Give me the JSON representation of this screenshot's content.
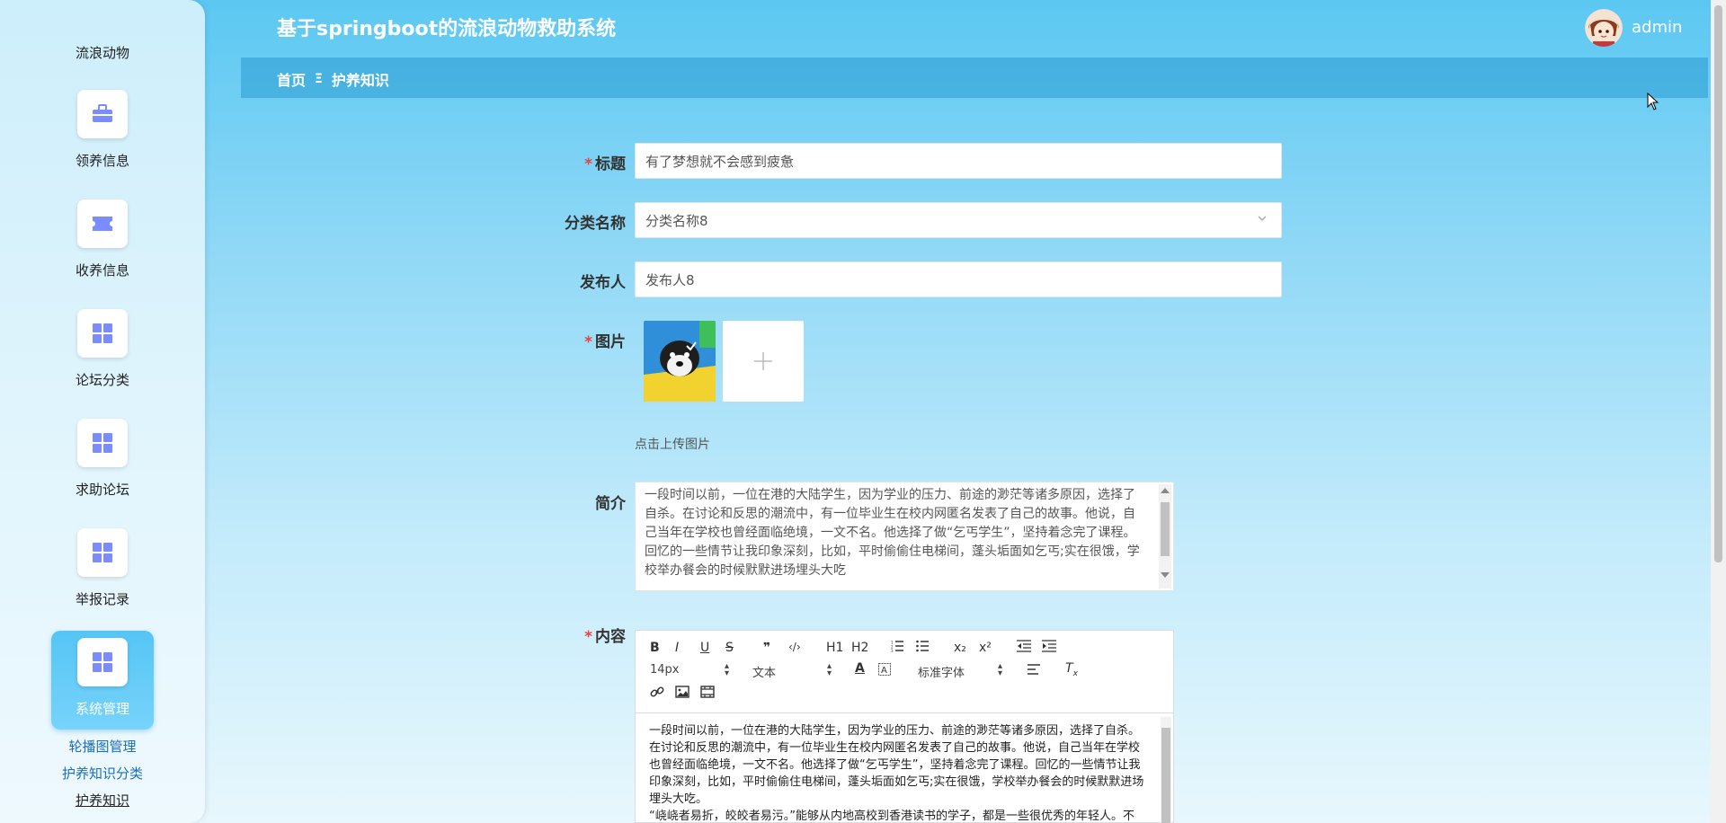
{
  "app": {
    "title": "基于springboot的流浪动物救助系统",
    "username": "admin"
  },
  "sidebar": {
    "top_label": "流浪动物",
    "items": [
      {
        "label": "领养信息",
        "icon": "briefcase-icon"
      },
      {
        "label": "收养信息",
        "icon": "ticket-icon"
      },
      {
        "label": "论坛分类",
        "icon": "grid-icon"
      },
      {
        "label": "求助论坛",
        "icon": "grid-icon"
      },
      {
        "label": "举报记录",
        "icon": "grid-icon"
      },
      {
        "label": "系统管理",
        "icon": "grid-icon",
        "active": true
      }
    ],
    "sub_items": [
      "轮播图管理",
      "护养知识分类",
      "护养知识"
    ]
  },
  "breadcrumb": {
    "home": "首页",
    "separator": "Ξ",
    "current": "护养知识"
  },
  "form": {
    "title": {
      "label": "标题",
      "value": "有了梦想就不会感到疲惫"
    },
    "category": {
      "label": "分类名称",
      "value": "分类名称8"
    },
    "publisher": {
      "label": "发布人",
      "value": "发布人8"
    },
    "image": {
      "label": "图片",
      "upload_hint": "点击上传图片"
    },
    "summary": {
      "label": "简介",
      "value": "一段时间以前，一位在港的大陆学生，因为学业的压力、前途的渺茫等诸多原因，选择了自杀。在讨论和反思的潮流中，有一位毕业生在校内网匿名发表了自己的故事。他说，自己当年在学校也曾经面临绝境，一文不名。他选择了做“乞丐学生”，坚持着念完了课程。回忆的一些情节让我印象深刻，比如，平时偷偷住电梯间，蓬头垢面如乞丐;实在很饿，学校举办餐会的时候默默进场埋头大吃"
    },
    "content": {
      "label": "内容",
      "toolbar": {
        "bold": "B",
        "italic": "I",
        "underline": "U",
        "strike": "S",
        "quote": "❞",
        "code": "‹/›",
        "h1": "H1",
        "h2": "H2",
        "sub": "x₂",
        "sup": "x²",
        "font_size": "14px",
        "format": "文本",
        "font_family": "标准字体"
      },
      "paragraphs": [
        "一段时间以前，一位在港的大陆学生，因为学业的压力、前途的渺茫等诸多原因，选择了自杀。在讨论和反思的潮流中，有一位毕业生在校内网匿名发表了自己的故事。他说，自己当年在学校也曾经面临绝境，一文不名。他选择了做“乞丐学生”，坚持着念完了课程。回忆的一些情节让我印象深刻，比如，平时偷偷住电梯间，蓬头垢面如乞丐;实在很饿，学校举办餐会的时候默默进场埋头大吃。",
        "“峣峣者易折，皎皎者易污。”能够从内地高校到香港读书的学子，都是一些很优秀的年轻人。不"
      ]
    }
  },
  "colors": {
    "accent": "#7b8cff",
    "header_text": "#ffffff",
    "required": "#e64242"
  }
}
